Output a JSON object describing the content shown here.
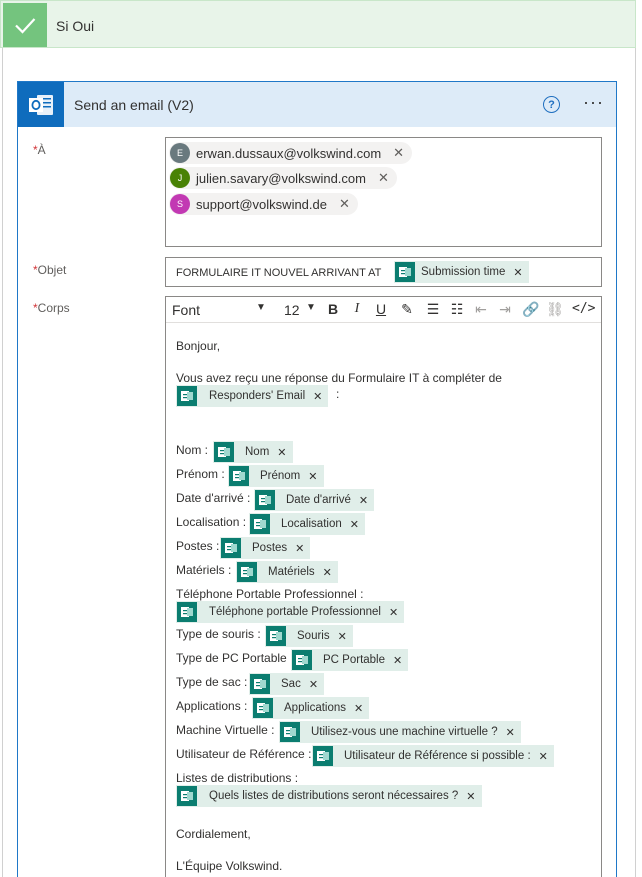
{
  "condition": {
    "title": "Si Oui"
  },
  "action": {
    "title": "Send an email (V2)",
    "help": "?",
    "more": "···"
  },
  "fields": {
    "to_label": "À",
    "subject_label": "Objet",
    "body_label": "Corps",
    "required_mark": "*"
  },
  "recipients": [
    {
      "initial": "E",
      "email": "erwan.dussaux@volkswind.com",
      "color": "#69797e"
    },
    {
      "initial": "J",
      "email": "julien.savary@volkswind.com",
      "color": "#498205"
    },
    {
      "initial": "S",
      "email": "support@volkswind.de",
      "color": "#c239b3"
    }
  ],
  "remove_symbol": "✕",
  "subject": {
    "text": "FORMULAIRE IT NOUVEL ARRIVANT AT",
    "token": "Submission time"
  },
  "toolbar": {
    "font": "Font",
    "size": "12"
  },
  "body": {
    "greeting": "Bonjour,",
    "intro": "Vous avez reçu une réponse du Formulaire IT à compléter de",
    "intro_token": "Responders' Email",
    "intro_suffix": ":",
    "lines": [
      {
        "label": "Nom :",
        "token": "Nom"
      },
      {
        "label": "Prénom :",
        "token": "Prénom"
      },
      {
        "label": "Date d'arrivé :",
        "token": "Date d'arrivé"
      },
      {
        "label": "Localisation :",
        "token": "Localisation"
      },
      {
        "label": "Postes :",
        "token": "Postes"
      },
      {
        "label": "Matériels :",
        "token": "Matériels"
      }
    ],
    "phone_label": "Téléphone Portable Professionnel :",
    "phone_token": "Téléphone portable Professionnel",
    "lines2": [
      {
        "label": "Type de souris :",
        "token": "Souris"
      },
      {
        "label": "Type de PC Portable :",
        "token": "PC Portable"
      },
      {
        "label": "Type de sac :",
        "token": "Sac"
      },
      {
        "label": "Applications :",
        "token": "Applications"
      },
      {
        "label": "Machine Virtuelle :",
        "token": "Utilisez-vous une machine virtuelle ?"
      },
      {
        "label": "Utilisateur de Référence :",
        "token": "Utilisateur de Référence si possible :"
      }
    ],
    "lists_label": "Listes de distributions :",
    "lists_token": "Quels listes de distributions seront nécessaires ?",
    "closing": "Cordialement,",
    "signature": "L'Équipe Volkswind."
  }
}
